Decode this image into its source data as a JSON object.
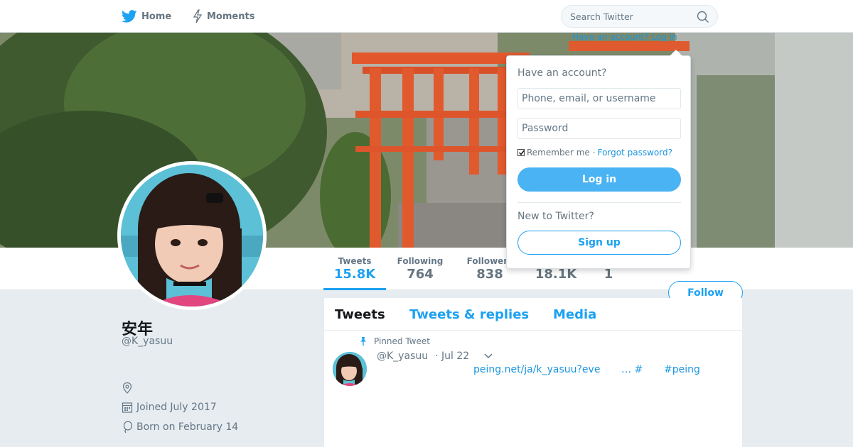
{
  "nav": {
    "home_label": "Home",
    "moments_label": "Moments",
    "search_placeholder": "Search Twitter"
  },
  "profile": {
    "name": "安年",
    "handle": "@K_yasuu",
    "location": "",
    "joined": "Joined July 2017",
    "born": "Born on February 14"
  },
  "stats": [
    {
      "label": "Tweets",
      "value": "15.8K"
    },
    {
      "label": "Following",
      "value": "764"
    },
    {
      "label": "Followers",
      "value": "838"
    },
    {
      "label": "",
      "value": "18.1K"
    },
    {
      "label": "",
      "value": "1"
    }
  ],
  "follow_label": "Follow",
  "tabs": [
    "Tweets",
    "Tweets & replies",
    "Media"
  ],
  "tweet": {
    "pinned_label": "Pinned Tweet",
    "handle": "@K_yasuu",
    "date": "· Jul 22",
    "link": "peing.net/ja/k_yasuu?eve",
    "ellipsis": "… #",
    "hashtag": "#peing"
  },
  "login": {
    "link_text": "Have an account? Log in",
    "title": "Have an account?",
    "username_placeholder": "Phone, email, or username",
    "password_placeholder": "Password",
    "remember": "Remember me",
    "separator": "·",
    "forgot": "Forgot password?",
    "login_button": "Log in",
    "new_text": "New to Twitter?",
    "signup_button": "Sign up"
  },
  "colors": {
    "accent": "#1da1f2",
    "link": "#1b95e0",
    "background": "#e6ecf0"
  }
}
